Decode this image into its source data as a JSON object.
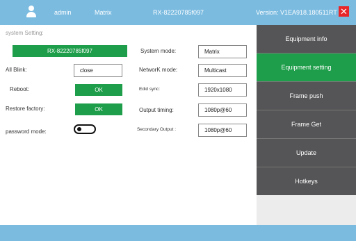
{
  "header": {
    "user": "admin",
    "mode": "Matrix",
    "device": "RX-82220785f097",
    "version": "Version: V1EA918.180511RT",
    "close_symbol": "✕",
    "user_icon": "user-icon",
    "bg_color": "#7bbbe0",
    "close_color": "#e8262a"
  },
  "settings": {
    "title": "system Setting:",
    "device_name": "RX-82220785f097",
    "all_blink_label": "All Blink:",
    "all_blink_value": "close",
    "reboot_label": "Reboot:",
    "reboot_button": "OK",
    "restore_label": "Restore factory:",
    "restore_button": "OK",
    "password_label": "password mode:",
    "password_toggle_on": false,
    "system_mode_label": "System mode:",
    "system_mode_value": "Matrix",
    "network_mode_label": "NetworK mode:",
    "network_mode_value": "Multicast",
    "edid_label": "Edid sync:",
    "edid_value": "1920x1080",
    "output_timing_label": "Output timing:",
    "output_timing_value": "1080p@60",
    "secondary_output_label": "Secondary Output :",
    "secondary_output_value": "1080p@60",
    "accent_color": "#1e9e4a"
  },
  "sidebar": {
    "items": [
      {
        "label": "Equipment info",
        "active": false
      },
      {
        "label": "Equipment setting",
        "active": true
      },
      {
        "label": "Frame push",
        "active": false
      },
      {
        "label": "Frame Get",
        "active": false
      },
      {
        "label": "Update",
        "active": false
      },
      {
        "label": "Hotkeys",
        "active": false
      }
    ],
    "item_color": "#555557",
    "active_color": "#1e9e4a"
  }
}
